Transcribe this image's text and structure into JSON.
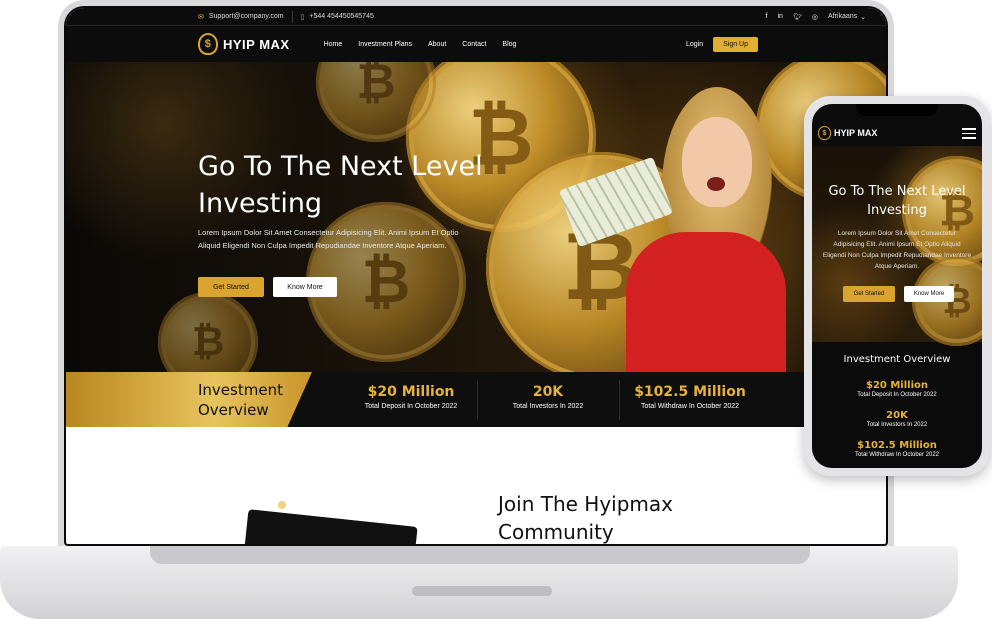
{
  "topbar": {
    "email": "Support@company.com",
    "phone": "+544 454450545745",
    "social": [
      "f",
      "in",
      "t",
      "ig"
    ],
    "language": "Afrikaans"
  },
  "nav": {
    "brand": "HYIP MAX",
    "items": [
      "Home",
      "Investment Plans",
      "About",
      "Contact",
      "Blog"
    ],
    "login": "Login",
    "signup": "Sign Up"
  },
  "hero": {
    "title_line1": "Go To The Next Level",
    "title_line2": "Investing",
    "text": "Lorem Ipsum Dolor Sit Amet Consectetur Adipisicing Elit. Animi Ipsum Et Optio Aliquid Eligendi Non Culpa Impedit Repudiandae Inventore Atque Aperiam.",
    "cta_primary": "Get Started",
    "cta_secondary": "Know More"
  },
  "overview": {
    "title_line1": "Investment",
    "title_line2": "Overview",
    "stats": [
      {
        "value": "$20 Million",
        "label": "Total Deposit In October 2022"
      },
      {
        "value": "20K",
        "label": "Total Investors In 2022"
      },
      {
        "value": "$102.5 Million",
        "label": "Total Withdraw In October 2022"
      }
    ]
  },
  "join": {
    "title_line1": "Join The Hyipmax",
    "title_line2": "Community"
  },
  "mobile": {
    "brand": "HYIP MAX",
    "title_line1": "Go To The Next Level",
    "title_line2": "Investing",
    "text": "Lorem Ipsum Dolor Sit Amet Consectetur Adipisicing Elit. Animi Ipsum Et Optio Aliquid Eligendi Non Culpa Impedit Repudiandae Inventore Atque Aperiam.",
    "cta_primary": "Get Started",
    "cta_secondary": "Know More",
    "overview_title": "Investment Overview",
    "stats": [
      {
        "value": "$20 Million",
        "label": "Total Deposit In October 2022"
      },
      {
        "value": "20K",
        "label": "Total Investors In 2022"
      },
      {
        "value": "$102.5 Million",
        "label": "Total Withdraw In October 2022"
      }
    ]
  },
  "colors": {
    "accent_gold": "#e1ad32",
    "background_dark": "#0c0c0c",
    "hero_red_shirt": "#d32020"
  }
}
